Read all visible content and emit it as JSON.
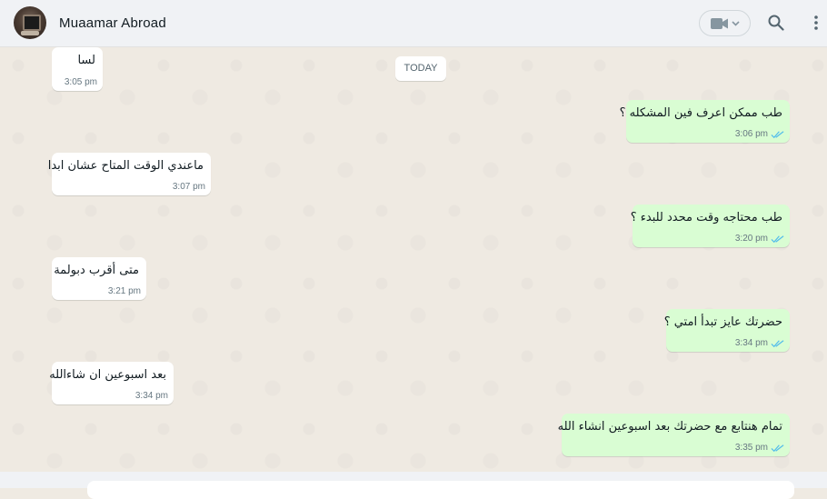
{
  "header": {
    "contact_name": "Muaamar Abroad",
    "avatar_icon": "contact-photo",
    "video_icon": "video-camera-icon",
    "search_icon": "search-icon",
    "menu_icon": "kebab-menu-icon"
  },
  "chat": {
    "date_separator": "TODAY",
    "messages": [
      {
        "direction": "in",
        "text": "لسا",
        "time": "3:05 pm"
      },
      {
        "direction": "out",
        "text": "طب ممكن اعرف فين المشكله ؟",
        "time": "3:06 pm",
        "status": "read"
      },
      {
        "direction": "in",
        "text": "ماعندي الوقت المتاح عشان ابدا",
        "time": "3:07 pm"
      },
      {
        "direction": "out",
        "text": "طب محتاجه وقت محدد للبدء ؟",
        "time": "3:20 pm",
        "status": "read"
      },
      {
        "direction": "in",
        "text": "متى أقرب دبولمة",
        "time": "3:21 pm"
      },
      {
        "direction": "out",
        "text": "حضرتك عايز تبدأ امتي ؟",
        "time": "3:34 pm",
        "status": "read"
      },
      {
        "direction": "in",
        "text": "بعد اسبوعين ان شاءالله",
        "time": "3:34 pm"
      },
      {
        "direction": "out",
        "text": "تمام هنتابع مع حضرتك بعد اسبوعين انشاء الله",
        "time": "3:35 pm",
        "status": "read"
      }
    ]
  },
  "colors": {
    "incoming_bubble": "#ffffff",
    "outgoing_bubble": "#d9fdd3",
    "read_ticks": "#53bdeb",
    "chat_background": "#efeae2"
  }
}
